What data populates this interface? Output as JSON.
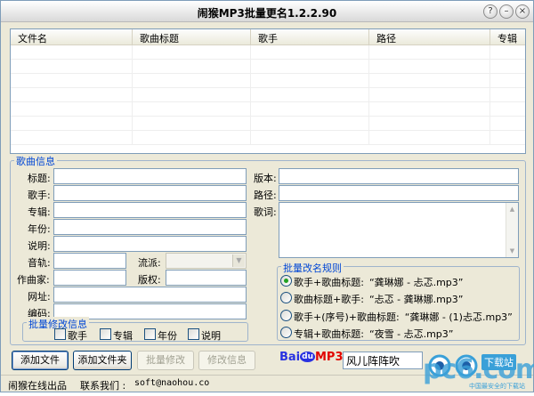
{
  "window": {
    "title": "闹猴MP3批量更名1.2.2.90",
    "help": "?",
    "close": "×",
    "minimize": "–"
  },
  "list": {
    "columns": [
      "文件名",
      "歌曲标题",
      "歌手",
      "路径",
      "专辑"
    ]
  },
  "song_info": {
    "legend": "歌曲信息",
    "title_label": "标题:",
    "singer_label": "歌手:",
    "album_label": "专辑:",
    "year_label": "年份:",
    "desc_label": "说明:",
    "track_label": "音轨:",
    "genre_label": "流派:",
    "composer_label": "作曲家:",
    "copyright_label": "版权:",
    "url_label": "网址:",
    "encode_label": "编码:",
    "version_label": "版本:",
    "path_label": "路径:",
    "lyrics_label": "歌词:"
  },
  "batch_info": {
    "legend": "批量修改信息",
    "options": [
      "歌手",
      "专辑",
      "年份",
      "说明"
    ]
  },
  "rename_rules": {
    "legend": "批量改名规则",
    "selected": 0,
    "options": [
      {
        "pattern": "歌手+歌曲标题:",
        "example": "“龚琳娜 - 忐忑.mp3”"
      },
      {
        "pattern": "歌曲标题+歌手:",
        "example": "“忐忑 - 龚琳娜.mp3”"
      },
      {
        "pattern": "歌手+(序号)+歌曲标题:",
        "example": "“龚琳娜 - (1)忐忑.mp3”"
      },
      {
        "pattern": "专辑+歌曲标题:",
        "example": "“夜雪 - 忐忑.mp3”"
      }
    ]
  },
  "buttons": {
    "add_file": "添加文件",
    "add_folder": "添加文件夹",
    "batch_modify": "批量修改",
    "modify_info": "修改信息"
  },
  "baidu": {
    "logo_bai": "Bai",
    "logo_du": "du",
    "logo_mp3": "MP3",
    "search_value": "风儿阵阵吹"
  },
  "status": {
    "vendor": "闹猴在线出品",
    "contact_label": "联系我们 :",
    "email": "soft@naohou.co"
  },
  "watermark": {
    "brand": "pc6.com",
    "badge": "下载站",
    "tagline": "中国最安全的下载站"
  },
  "colors": {
    "accent": "#0046d5",
    "window_bg": "#ece9d8",
    "border": "#7f9db9",
    "baidu_blue": "#2932e1",
    "baidu_red": "#e10602"
  }
}
